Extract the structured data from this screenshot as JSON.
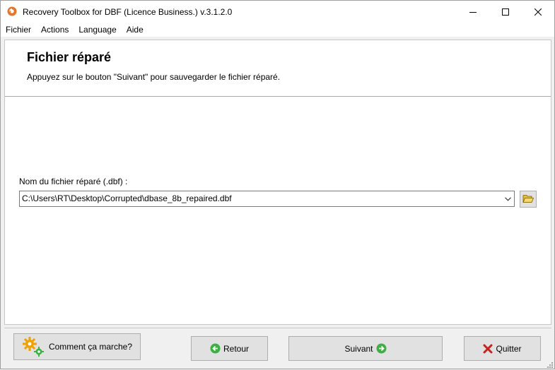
{
  "window": {
    "title": "Recovery Toolbox for DBF (Licence Business.) v.3.1.2.0",
    "controls": {
      "minimize": "minimize",
      "maximize": "maximize",
      "close": "close"
    }
  },
  "menu": {
    "items": [
      "Fichier",
      "Actions",
      "Language",
      "Aide"
    ]
  },
  "header": {
    "title": "Fichier réparé",
    "subtitle": "Appuyez sur le bouton \"Suivant\" pour sauvegarder le fichier réparé."
  },
  "form": {
    "file_label": "Nom du fichier réparé (.dbf) :",
    "file_value": "C:\\Users\\RT\\Desktop\\Corrupted\\dbase_8b_repaired.dbf"
  },
  "buttons": {
    "help": "Comment ça marche?",
    "back": "Retour",
    "next": "Suivant",
    "quit": "Quitter"
  },
  "icons": {
    "app": "app-logo-icon",
    "browse": "open-folder-icon",
    "help": "gears-icon",
    "back": "arrow-left-circle-icon",
    "next": "arrow-right-circle-icon",
    "quit": "red-x-icon"
  },
  "colors": {
    "accent_green": "#3cb043",
    "quit_red": "#c8201e",
    "gear_orange": "#f0a000",
    "app_icon_orange": "#e8742a"
  }
}
